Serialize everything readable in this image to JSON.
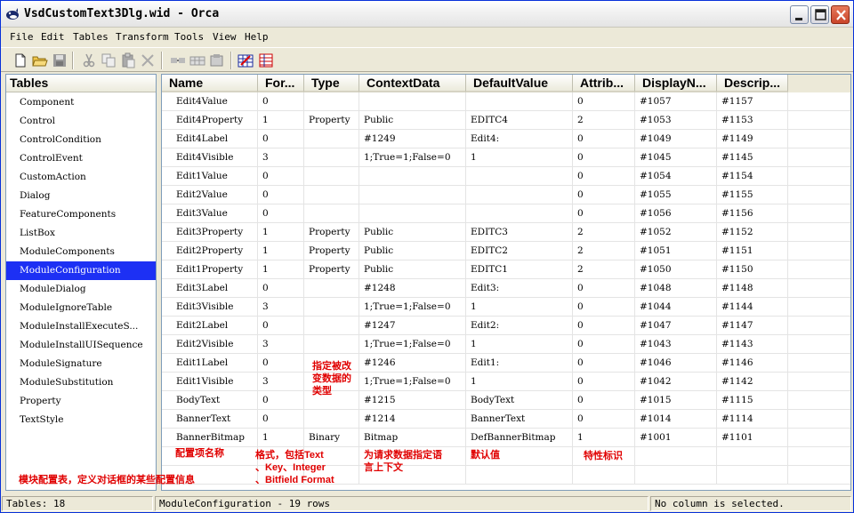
{
  "window": {
    "title": "VsdCustomText3Dlg.wid - Orca"
  },
  "menubar": {
    "items": [
      {
        "label": "File"
      },
      {
        "label": "Edit"
      },
      {
        "label": "Tables"
      },
      {
        "label": "Transform"
      },
      {
        "label": "Tools"
      },
      {
        "label": "View"
      },
      {
        "label": "Help"
      }
    ]
  },
  "toolbar": {
    "icons": [
      "new-file-icon",
      "open-folder-icon",
      "save-icon",
      "cut-icon",
      "copy-icon",
      "paste-icon",
      "delete-icon",
      "merge-module-icon",
      "table-icon",
      "row-icon",
      "validate-icon",
      "compare-icon"
    ]
  },
  "tables_panel": {
    "header": "Tables",
    "items": [
      "Component",
      "Control",
      "ControlCondition",
      "ControlEvent",
      "CustomAction",
      "Dialog",
      "FeatureComponents",
      "ListBox",
      "ModuleComponents",
      "ModuleConfiguration",
      "ModuleDialog",
      "ModuleIgnoreTable",
      "ModuleInstallExecuteS...",
      "ModuleInstallUISequence",
      "ModuleSignature",
      "ModuleSubstitution",
      "Property",
      "TextStyle"
    ],
    "selected": "ModuleConfiguration"
  },
  "grid": {
    "columns": [
      "Name",
      "For...",
      "Type",
      "ContextData",
      "DefaultValue",
      "Attrib...",
      "DisplayN...",
      "Descrip..."
    ],
    "rows": [
      [
        "Edit4Value",
        "0",
        "",
        "",
        "",
        "0",
        "#1057",
        "#1157"
      ],
      [
        "Edit4Property",
        "1",
        "Property",
        "Public",
        "EDITC4",
        "2",
        "#1053",
        "#1153"
      ],
      [
        "Edit4Label",
        "0",
        "",
        "#1249",
        "Edit4:",
        "0",
        "#1049",
        "#1149"
      ],
      [
        "Edit4Visible",
        "3",
        "",
        "1;True=1;False=0",
        "1",
        "0",
        "#1045",
        "#1145"
      ],
      [
        "Edit1Value",
        "0",
        "",
        "",
        "",
        "0",
        "#1054",
        "#1154"
      ],
      [
        "Edit2Value",
        "0",
        "",
        "",
        "",
        "0",
        "#1055",
        "#1155"
      ],
      [
        "Edit3Value",
        "0",
        "",
        "",
        "",
        "0",
        "#1056",
        "#1156"
      ],
      [
        "Edit3Property",
        "1",
        "Property",
        "Public",
        "EDITC3",
        "2",
        "#1052",
        "#1152"
      ],
      [
        "Edit2Property",
        "1",
        "Property",
        "Public",
        "EDITC2",
        "2",
        "#1051",
        "#1151"
      ],
      [
        "Edit1Property",
        "1",
        "Property",
        "Public",
        "EDITC1",
        "2",
        "#1050",
        "#1150"
      ],
      [
        "Edit3Label",
        "0",
        "",
        "#1248",
        "Edit3:",
        "0",
        "#1048",
        "#1148"
      ],
      [
        "Edit3Visible",
        "3",
        "",
        "1;True=1;False=0",
        "1",
        "0",
        "#1044",
        "#1144"
      ],
      [
        "Edit2Label",
        "0",
        "",
        "#1247",
        "Edit2:",
        "0",
        "#1047",
        "#1147"
      ],
      [
        "Edit2Visible",
        "3",
        "",
        "1;True=1;False=0",
        "1",
        "0",
        "#1043",
        "#1143"
      ],
      [
        "Edit1Label",
        "0",
        "",
        "#1246",
        "Edit1:",
        "0",
        "#1046",
        "#1146"
      ],
      [
        "Edit1Visible",
        "3",
        "",
        "1;True=1;False=0",
        "1",
        "0",
        "#1042",
        "#1142"
      ],
      [
        "BodyText",
        "0",
        "",
        "#1215",
        "BodyText",
        "0",
        "#1015",
        "#1115"
      ],
      [
        "BannerText",
        "0",
        "",
        "#1214",
        "BannerText",
        "0",
        "#1014",
        "#1114"
      ],
      [
        "BannerBitmap",
        "1",
        "Binary",
        "Bitmap",
        "DefBannerBitmap",
        "1",
        "#1001",
        "#1101"
      ]
    ]
  },
  "annotations": {
    "type_note": [
      "指定被改",
      "变数据的",
      "类型"
    ],
    "name_note": "配置项名称",
    "format_note": [
      "格式，包括Text",
      "、Key、Integer",
      "、Bitfield Format"
    ],
    "context_note": [
      "为请求数据指定语",
      "言上下文"
    ],
    "default_note": "默认值",
    "attrib_note": "特性标识",
    "table_note": "模块配置表，定义对话框的某些配置信息"
  },
  "statusbar": {
    "tables": "Tables: 18",
    "rows": "ModuleConfiguration - 19 rows",
    "selection": "No column is selected."
  },
  "colors": {
    "selection": "#1D30F4",
    "annotation": "#E00000"
  }
}
